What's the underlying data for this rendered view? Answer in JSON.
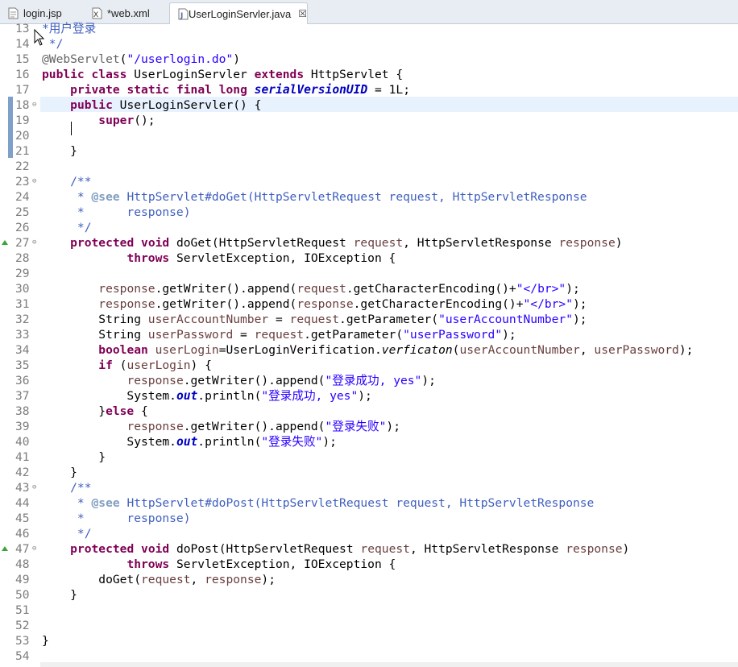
{
  "tabs": [
    {
      "label": "login.jsp",
      "icon": "jsp-file-icon"
    },
    {
      "label": "*web.xml",
      "icon": "xml-file-icon"
    },
    {
      "label": "UserLoginServler.java",
      "icon": "java-file-icon",
      "active": true,
      "close": "☒"
    }
  ],
  "lines": [
    {
      "n": "13",
      "segs": [
        [
          "cm",
          "*用户登录"
        ]
      ]
    },
    {
      "n": "14",
      "segs": [
        [
          "cm",
          " */"
        ]
      ]
    },
    {
      "n": "15",
      "segs": [
        [
          "ann",
          "@WebServlet"
        ],
        [
          "",
          "("
        ],
        [
          "str",
          "\"/userlogin.do\""
        ],
        [
          "",
          ")"
        ]
      ]
    },
    {
      "n": "16",
      "segs": [
        [
          "kw",
          "public"
        ],
        [
          "",
          " "
        ],
        [
          "kw",
          "class"
        ],
        [
          "",
          " UserLoginServler "
        ],
        [
          "kw",
          "extends"
        ],
        [
          "",
          " HttpServlet {"
        ]
      ]
    },
    {
      "n": "17",
      "segs": [
        [
          "",
          "    "
        ],
        [
          "kw",
          "private"
        ],
        [
          "",
          " "
        ],
        [
          "kw",
          "static"
        ],
        [
          "",
          " "
        ],
        [
          "kw",
          "final"
        ],
        [
          "",
          " "
        ],
        [
          "kw",
          "long"
        ],
        [
          "",
          " "
        ],
        [
          "fld",
          "serialVersionUID"
        ],
        [
          "",
          " = 1L;"
        ]
      ]
    },
    {
      "n": "18",
      "fold": "⊖",
      "segs": [
        [
          "",
          "    "
        ],
        [
          "kw",
          "public"
        ],
        [
          "",
          " UserLoginServler() {"
        ]
      ]
    },
    {
      "n": "19",
      "segs": [
        [
          "",
          "        "
        ],
        [
          "kw",
          "super"
        ],
        [
          "",
          "();"
        ]
      ]
    },
    {
      "n": "20",
      "segs": [
        [
          "",
          ""
        ]
      ]
    },
    {
      "n": "21",
      "segs": [
        [
          "",
          "    }"
        ]
      ]
    },
    {
      "n": "22",
      "segs": [
        [
          "",
          ""
        ]
      ]
    },
    {
      "n": "23",
      "fold": "⊖",
      "segs": [
        [
          "cm",
          "    /**"
        ]
      ]
    },
    {
      "n": "24",
      "segs": [
        [
          "cm",
          "     * "
        ],
        [
          "cmk",
          "@see"
        ],
        [
          "cm",
          " HttpServlet#doGet(HttpServletRequest request, HttpServletResponse"
        ]
      ]
    },
    {
      "n": "25",
      "segs": [
        [
          "cm",
          "     *      response)"
        ]
      ]
    },
    {
      "n": "26",
      "segs": [
        [
          "cm",
          "     */"
        ]
      ]
    },
    {
      "n": "27",
      "fold": "⊖",
      "ovr": true,
      "segs": [
        [
          "",
          "    "
        ],
        [
          "kw",
          "protected"
        ],
        [
          "",
          " "
        ],
        [
          "kw",
          "void"
        ],
        [
          "",
          " doGet(HttpServletRequest "
        ],
        [
          "par",
          "request"
        ],
        [
          "",
          ", HttpServletResponse "
        ],
        [
          "par",
          "response"
        ],
        [
          "",
          ")"
        ]
      ]
    },
    {
      "n": "28",
      "segs": [
        [
          "",
          "            "
        ],
        [
          "kw",
          "throws"
        ],
        [
          "",
          " ServletException, IOException {"
        ]
      ]
    },
    {
      "n": "29",
      "segs": [
        [
          "",
          ""
        ]
      ]
    },
    {
      "n": "30",
      "segs": [
        [
          "",
          "        "
        ],
        [
          "par",
          "response"
        ],
        [
          "",
          ".getWriter().append("
        ],
        [
          "par",
          "request"
        ],
        [
          "",
          ".getCharacterEncoding()+"
        ],
        [
          "str",
          "\"</br>\""
        ],
        [
          "",
          ");"
        ]
      ]
    },
    {
      "n": "31",
      "segs": [
        [
          "",
          "        "
        ],
        [
          "par",
          "response"
        ],
        [
          "",
          ".getWriter().append("
        ],
        [
          "par",
          "response"
        ],
        [
          "",
          ".getCharacterEncoding()+"
        ],
        [
          "str",
          "\"</br>\""
        ],
        [
          "",
          ");"
        ]
      ]
    },
    {
      "n": "32",
      "segs": [
        [
          "",
          "        String "
        ],
        [
          "par",
          "userAccountNumber"
        ],
        [
          "",
          " = "
        ],
        [
          "par",
          "request"
        ],
        [
          "",
          ".getParameter("
        ],
        [
          "str",
          "\"userAccountNumber\""
        ],
        [
          "",
          ");"
        ]
      ]
    },
    {
      "n": "33",
      "segs": [
        [
          "",
          "        String "
        ],
        [
          "par",
          "userPassword"
        ],
        [
          "",
          " = "
        ],
        [
          "par",
          "request"
        ],
        [
          "",
          ".getParameter("
        ],
        [
          "str",
          "\"userPassword\""
        ],
        [
          "",
          ");"
        ]
      ]
    },
    {
      "n": "34",
      "segs": [
        [
          "",
          "        "
        ],
        [
          "kw",
          "boolean"
        ],
        [
          "",
          " "
        ],
        [
          "par",
          "userLogin"
        ],
        [
          "",
          "=UserLoginVerification."
        ],
        [
          "stat",
          "verficaton"
        ],
        [
          "",
          "("
        ],
        [
          "par",
          "userAccountNumber"
        ],
        [
          "",
          ", "
        ],
        [
          "par",
          "userPassword"
        ],
        [
          "",
          ");"
        ]
      ]
    },
    {
      "n": "35",
      "segs": [
        [
          "",
          "        "
        ],
        [
          "kw",
          "if"
        ],
        [
          "",
          " ("
        ],
        [
          "par",
          "userLogin"
        ],
        [
          "",
          ") {"
        ]
      ]
    },
    {
      "n": "36",
      "segs": [
        [
          "",
          "            "
        ],
        [
          "par",
          "response"
        ],
        [
          "",
          ".getWriter().append("
        ],
        [
          "str",
          "\"登录成功, yes\""
        ],
        [
          "",
          ");"
        ]
      ]
    },
    {
      "n": "37",
      "segs": [
        [
          "",
          "            System."
        ],
        [
          "fld",
          "out"
        ],
        [
          "",
          ".println("
        ],
        [
          "str",
          "\"登录成功, yes\""
        ],
        [
          "",
          ");"
        ]
      ]
    },
    {
      "n": "38",
      "segs": [
        [
          "",
          "        }"
        ],
        [
          "kw",
          "else"
        ],
        [
          "",
          " {"
        ]
      ]
    },
    {
      "n": "39",
      "segs": [
        [
          "",
          "            "
        ],
        [
          "par",
          "response"
        ],
        [
          "",
          ".getWriter().append("
        ],
        [
          "str",
          "\"登录失败\""
        ],
        [
          "",
          ");"
        ]
      ]
    },
    {
      "n": "40",
      "segs": [
        [
          "",
          "            System."
        ],
        [
          "fld",
          "out"
        ],
        [
          "",
          ".println("
        ],
        [
          "str",
          "\"登录失败\""
        ],
        [
          "",
          ");"
        ]
      ]
    },
    {
      "n": "41",
      "segs": [
        [
          "",
          "        }"
        ]
      ]
    },
    {
      "n": "42",
      "segs": [
        [
          "",
          "    }"
        ]
      ]
    },
    {
      "n": "43",
      "fold": "⊖",
      "segs": [
        [
          "cm",
          "    /**"
        ]
      ]
    },
    {
      "n": "44",
      "segs": [
        [
          "cm",
          "     * "
        ],
        [
          "cmk",
          "@see"
        ],
        [
          "cm",
          " HttpServlet#doPost(HttpServletRequest request, HttpServletResponse"
        ]
      ]
    },
    {
      "n": "45",
      "segs": [
        [
          "cm",
          "     *      response)"
        ]
      ]
    },
    {
      "n": "46",
      "segs": [
        [
          "cm",
          "     */"
        ]
      ]
    },
    {
      "n": "47",
      "fold": "⊖",
      "ovr": true,
      "segs": [
        [
          "",
          "    "
        ],
        [
          "kw",
          "protected"
        ],
        [
          "",
          " "
        ],
        [
          "kw",
          "void"
        ],
        [
          "",
          " doPost(HttpServletRequest "
        ],
        [
          "par",
          "request"
        ],
        [
          "",
          ", HttpServletResponse "
        ],
        [
          "par",
          "response"
        ],
        [
          "",
          ")"
        ]
      ]
    },
    {
      "n": "48",
      "segs": [
        [
          "",
          "            "
        ],
        [
          "kw",
          "throws"
        ],
        [
          "",
          " ServletException, IOException {"
        ]
      ]
    },
    {
      "n": "49",
      "segs": [
        [
          "",
          "        doGet("
        ],
        [
          "par",
          "request"
        ],
        [
          "",
          ", "
        ],
        [
          "par",
          "response"
        ],
        [
          "",
          ");"
        ]
      ]
    },
    {
      "n": "50",
      "segs": [
        [
          "",
          "    }"
        ]
      ]
    },
    {
      "n": "51",
      "segs": [
        [
          "",
          ""
        ]
      ]
    },
    {
      "n": "52",
      "segs": [
        [
          "",
          ""
        ]
      ]
    },
    {
      "n": "53",
      "segs": [
        [
          "",
          "}"
        ]
      ]
    },
    {
      "n": "54",
      "segs": [
        [
          "",
          ""
        ]
      ]
    }
  ]
}
